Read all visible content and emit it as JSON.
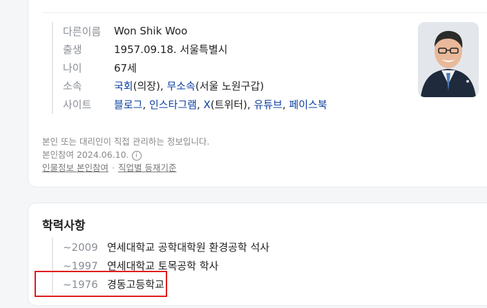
{
  "profile": {
    "rows": [
      {
        "label": "다른이름",
        "value": "Won Shik Woo"
      },
      {
        "label": "출생",
        "value": "1957.09.18. 서울특별시"
      },
      {
        "label": "나이",
        "value": "67세"
      }
    ],
    "affiliation": {
      "label": "소속",
      "link1": "국회",
      "text1": "(의장), ",
      "link2": "무소속",
      "text2": "(서울 노원구갑)"
    },
    "sites": {
      "label": "사이트",
      "links": [
        "블로그",
        "인스타그램",
        "X",
        "유튜브",
        "페이스북"
      ],
      "x_suffix": "(트위터)",
      "separator": ", "
    }
  },
  "note": {
    "line1": "본인 또는 대리인이 직접 관리하는 정보입니다.",
    "line2": "본인참여 2024.06.10.",
    "info_icon": "i",
    "link1": "인물정보 본인참여",
    "dot": "·",
    "link2": "직업별 등재기준"
  },
  "education": {
    "title": "학력사항",
    "items": [
      {
        "year": "~2009",
        "school": "연세대학교 공학대학원 환경공학 석사"
      },
      {
        "year": "~1997",
        "school": "연세대학교 토목공학 학사"
      },
      {
        "year": "~1976",
        "school": "경동고등학교"
      }
    ]
  },
  "colors": {
    "link": "#0b3fa0",
    "highlight": "#e01a1a"
  }
}
